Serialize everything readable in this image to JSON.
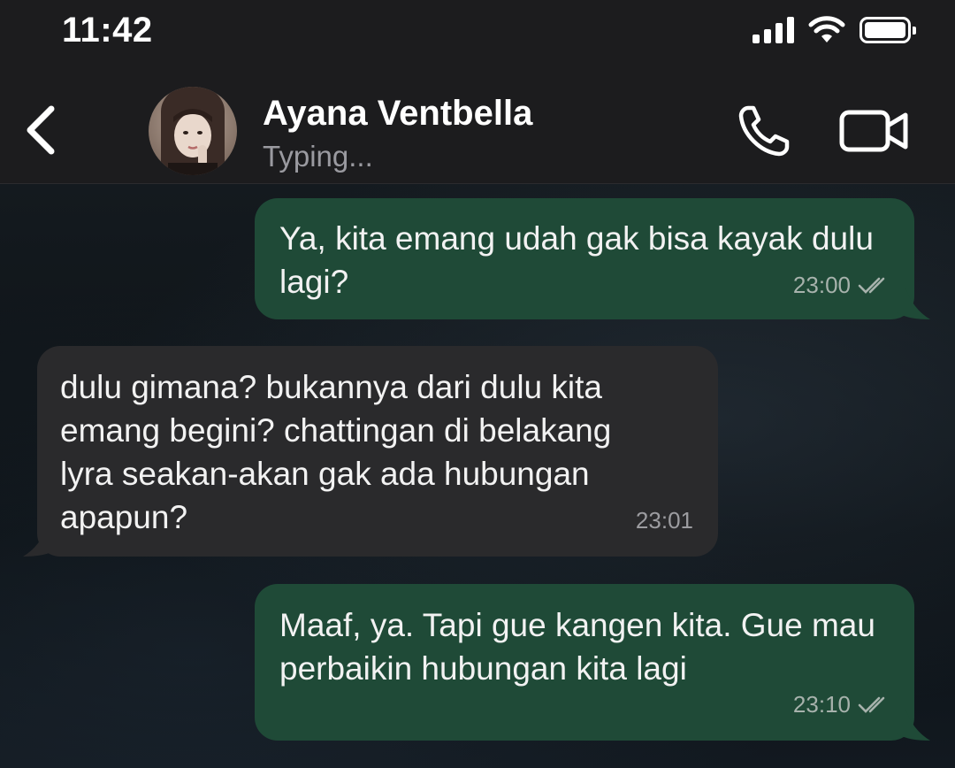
{
  "status_bar": {
    "time": "11:42",
    "icons": [
      "cellular-signal-icon",
      "wifi-icon",
      "battery-icon"
    ]
  },
  "header": {
    "back_icon": "chevron-left-icon",
    "contact_name": "Ayana Ventbella",
    "contact_status": "Typing...",
    "call_icon": "phone-icon",
    "video_icon": "video-camera-icon"
  },
  "messages": [
    {
      "direction": "outgoing",
      "text": "Ya, kita emang udah gak bisa kayak dulu lagi?",
      "time": "23:00",
      "read_receipt": "double-check-icon"
    },
    {
      "direction": "incoming",
      "text": "dulu gimana? bukannya dari dulu kita emang begini? chattingan di belakang lyra seakan-akan gak ada hubungan apapun?",
      "time": "23:01"
    },
    {
      "direction": "outgoing",
      "text": "Maaf, ya. Tapi gue kangen kita. Gue mau perbaikin hubungan kita lagi",
      "time": "23:10",
      "read_receipt": "double-check-icon"
    }
  ],
  "colors": {
    "header_bg": "#1c1c1e",
    "outgoing_bubble": "#1f4a37",
    "incoming_bubble": "#2a2a2c",
    "secondary_text": "#9a9aa0"
  }
}
